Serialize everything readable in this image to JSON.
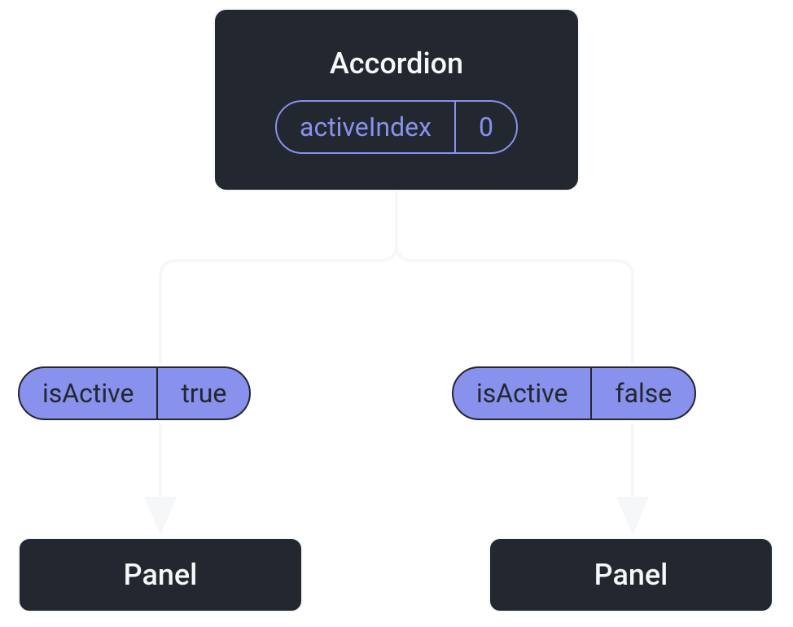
{
  "parent": {
    "label": "Accordion",
    "state": {
      "key": "activeIndex",
      "value": "0"
    }
  },
  "children": [
    {
      "prop": {
        "key": "isActive",
        "value": "true"
      },
      "label": "Panel"
    },
    {
      "prop": {
        "key": "isActive",
        "value": "false"
      },
      "label": "Panel"
    }
  ]
}
